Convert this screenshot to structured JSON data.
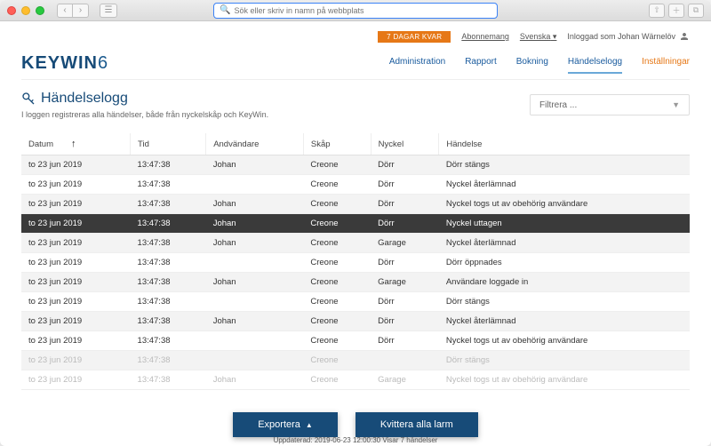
{
  "browser": {
    "url_placeholder": "Sök eller skriv in namn på webbplats"
  },
  "topbar": {
    "days_left_badge": "7 DAGAR KVAR",
    "subscription": "Abonnemang",
    "language": "Svenska",
    "logged_in_as": "Inloggad som Johan Wärnelöv"
  },
  "logo": {
    "brand": "KEYWIN",
    "version": "6"
  },
  "nav": {
    "administration": "Administration",
    "rapport": "Rapport",
    "bokning": "Bokning",
    "handelselogg": "Händelselogg",
    "installningar": "Inställningar"
  },
  "page": {
    "title": "Händelselogg",
    "subtitle": "I loggen registreras alla händelser, både från nyckelskåp och KeyWin.",
    "filter_placeholder": "Filtrera ..."
  },
  "columns": {
    "date": "Datum",
    "time": "Tid",
    "user": "Andvändare",
    "cabinet": "Skåp",
    "key": "Nyckel",
    "event": "Händelse"
  },
  "rows": [
    {
      "date": "to 23 jun 2019",
      "time": "13:47:38",
      "user": "Johan",
      "cabinet": "Creone",
      "key": "Dörr",
      "event": "Dörr stängs",
      "hl": false,
      "fade": false
    },
    {
      "date": "to 23 jun 2019",
      "time": "13:47:38",
      "user": "",
      "cabinet": "Creone",
      "key": "Dörr",
      "event": "Nyckel återlämnad",
      "hl": false,
      "fade": false
    },
    {
      "date": "to 23 jun 2019",
      "time": "13:47:38",
      "user": "Johan",
      "cabinet": "Creone",
      "key": "Dörr",
      "event": "Nyckel togs ut av obehörig användare",
      "hl": false,
      "fade": false
    },
    {
      "date": "to 23 jun 2019",
      "time": "13:47:38",
      "user": "Johan",
      "cabinet": "Creone",
      "key": "Dörr",
      "event": "Nyckel uttagen",
      "hl": true,
      "fade": false
    },
    {
      "date": "to 23 jun 2019",
      "time": "13:47:38",
      "user": "Johan",
      "cabinet": "Creone",
      "key": "Garage",
      "event": "Nyckel återlämnad",
      "hl": false,
      "fade": false
    },
    {
      "date": "to 23 jun 2019",
      "time": "13:47:38",
      "user": "",
      "cabinet": "Creone",
      "key": "Dörr",
      "event": "Dörr öppnades",
      "hl": false,
      "fade": false
    },
    {
      "date": "to 23 jun 2019",
      "time": "13:47:38",
      "user": "Johan",
      "cabinet": "Creone",
      "key": "Garage",
      "event": "Användare loggade in",
      "hl": false,
      "fade": false
    },
    {
      "date": "to 23 jun 2019",
      "time": "13:47:38",
      "user": "",
      "cabinet": "Creone",
      "key": "Dörr",
      "event": "Dörr stängs",
      "hl": false,
      "fade": false
    },
    {
      "date": "to 23 jun 2019",
      "time": "13:47:38",
      "user": "Johan",
      "cabinet": "Creone",
      "key": "Dörr",
      "event": "Nyckel återlämnad",
      "hl": false,
      "fade": false
    },
    {
      "date": "to 23 jun 2019",
      "time": "13:47:38",
      "user": "",
      "cabinet": "Creone",
      "key": "Dörr",
      "event": "Nyckel togs ut av obehörig användare",
      "hl": false,
      "fade": false
    },
    {
      "date": "to 23 jun 2019",
      "time": "13:47:38",
      "user": "",
      "cabinet": "Creone",
      "key": "",
      "event": "Dörr stängs",
      "hl": false,
      "fade": true
    },
    {
      "date": "to 23 jun 2019",
      "time": "13:47:38",
      "user": "Johan",
      "cabinet": "Creone",
      "key": "Garage",
      "event": "Nyckel togs ut av obehörig användare",
      "hl": false,
      "fade": true
    }
  ],
  "actions": {
    "export": "Exportera",
    "ack_all": "Kvittera alla larm"
  },
  "footer": {
    "status": "Uppdaterad: 2019-06-23 12:00:30 Visar 7 händelser"
  }
}
